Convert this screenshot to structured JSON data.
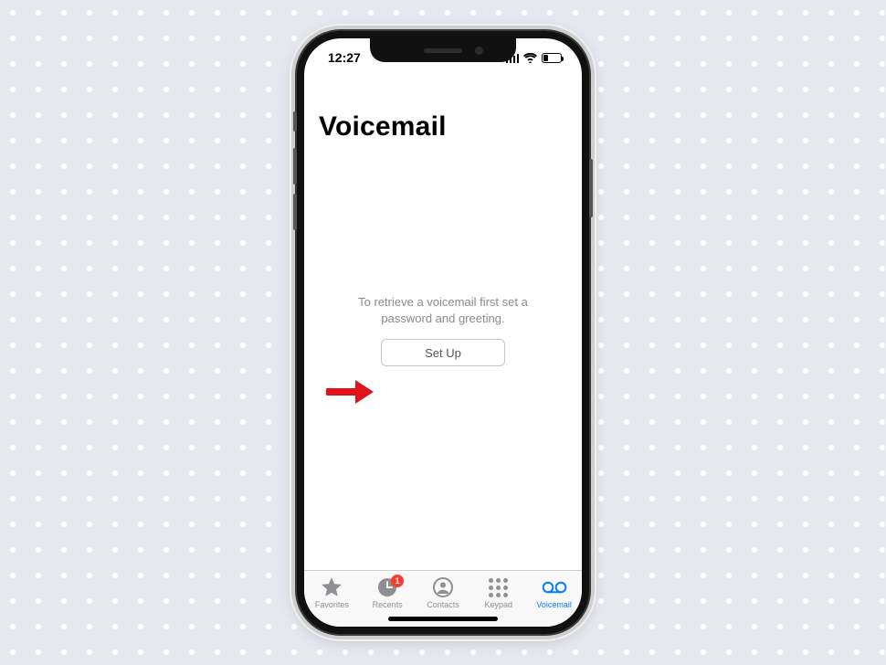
{
  "statusbar": {
    "time": "12:27"
  },
  "page": {
    "title": "Voicemail"
  },
  "empty_state": {
    "hint_line1": "To retrieve a voicemail first set a",
    "hint_line2": "password and greeting.",
    "button_label": "Set Up"
  },
  "tabs": {
    "favorites": {
      "label": "Favorites"
    },
    "recents": {
      "label": "Recents",
      "badge": "1"
    },
    "contacts": {
      "label": "Contacts"
    },
    "keypad": {
      "label": "Keypad"
    },
    "voicemail": {
      "label": "Voicemail"
    }
  },
  "colors": {
    "active": "#0a7cff",
    "inactive": "#8e8e93",
    "badge": "#ff3b30",
    "annotation": "#e1121a"
  }
}
